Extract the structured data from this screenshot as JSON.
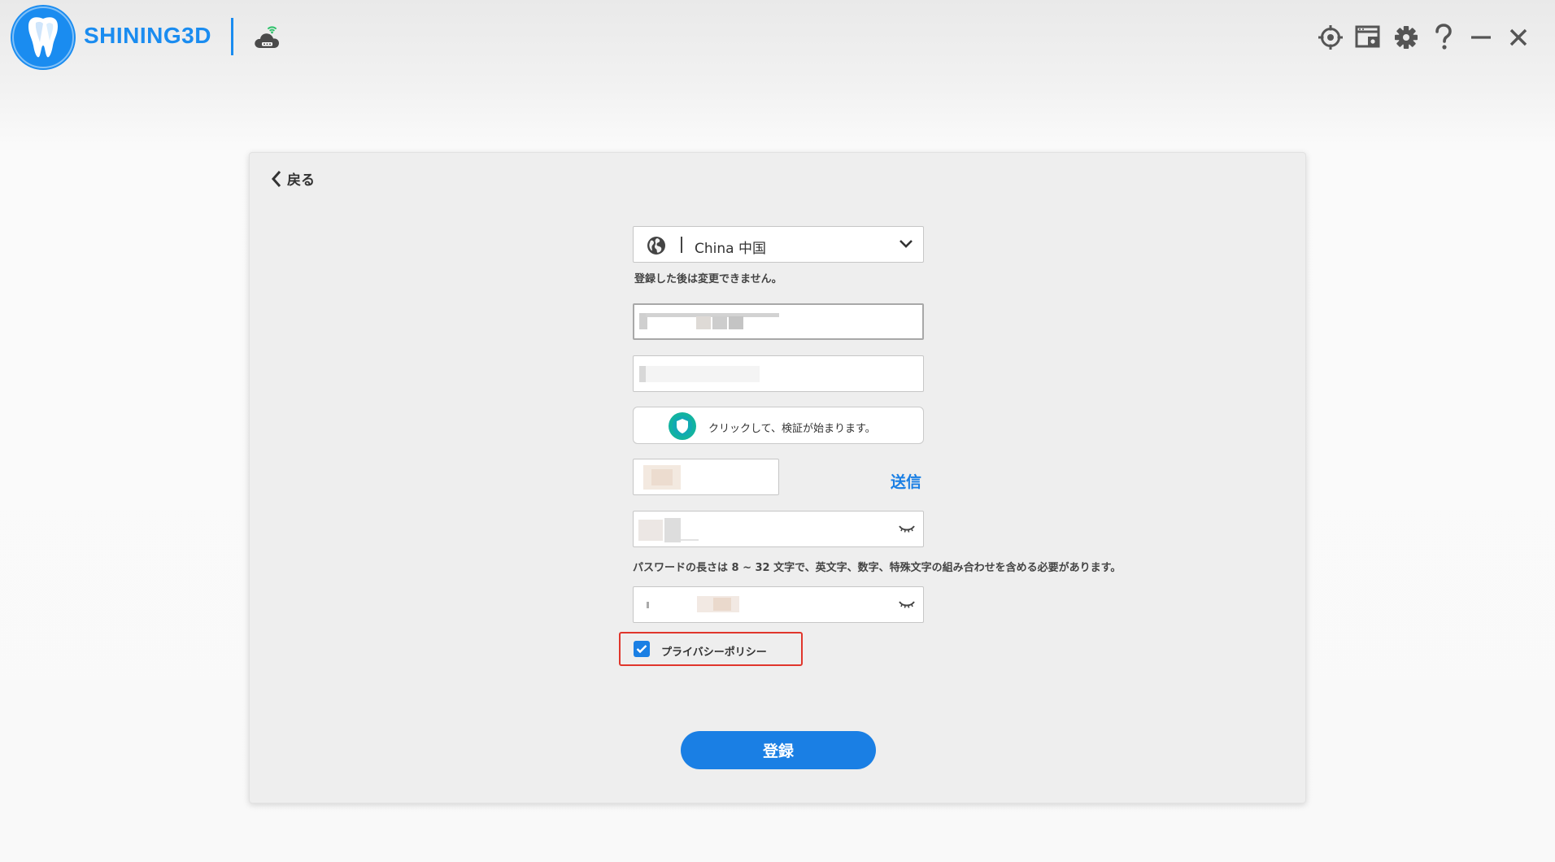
{
  "app": {
    "brand": "SHINING3D",
    "accent_color": "#1a8cf0",
    "icons": [
      "tooth-logo-icon",
      "cloud-connected-icon",
      "target-icon",
      "screen-capture-icon",
      "gear-icon",
      "help-icon",
      "minimize-icon",
      "close-icon"
    ]
  },
  "form": {
    "back_label": "戻る",
    "country": {
      "value": "China 中国",
      "icon": "globe-icon"
    },
    "country_note": "登録した後は変更できません。",
    "email": {
      "value": ""
    },
    "phone": {
      "value": ""
    },
    "verify_label": "クリックして、検証が始まります。",
    "code": {
      "value": ""
    },
    "send_label": "送信",
    "password": {
      "value": ""
    },
    "password_note": "パスワードの長さは 8 ~ 32 文字で、英文字、数字、特殊文字の組み合わせを含める必要があります。",
    "password_confirm": {
      "value": ""
    },
    "privacy": {
      "label": "プライバシーポリシー",
      "checked": true
    },
    "submit_label": "登録"
  }
}
